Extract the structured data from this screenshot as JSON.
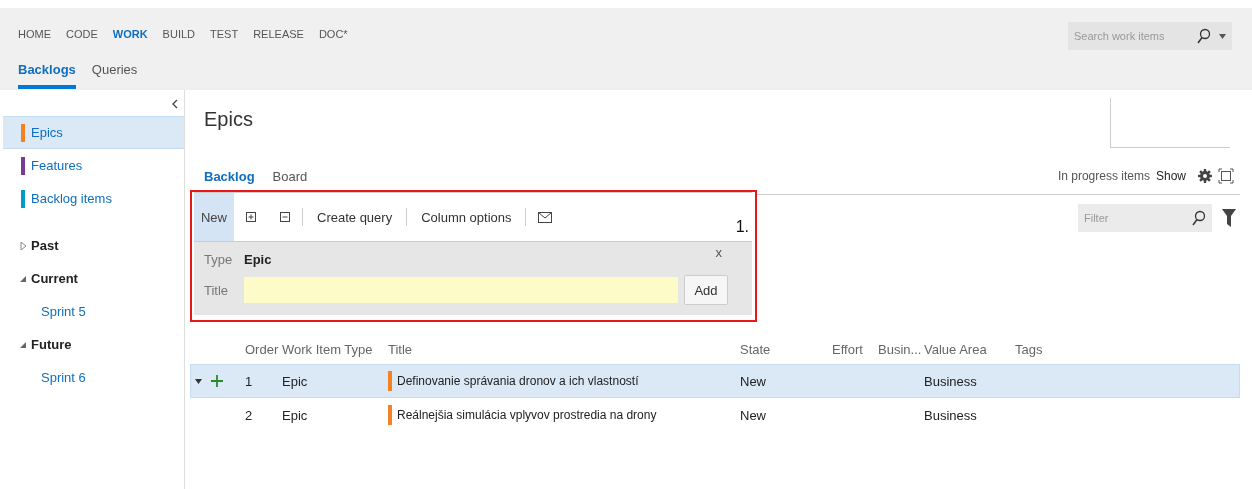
{
  "nav": {
    "hubs": [
      {
        "label": "HOME",
        "selected": false
      },
      {
        "label": "CODE",
        "selected": false
      },
      {
        "label": "WORK",
        "selected": true
      },
      {
        "label": "BUILD",
        "selected": false
      },
      {
        "label": "TEST",
        "selected": false
      },
      {
        "label": "RELEASE",
        "selected": false
      },
      {
        "label": "DOC*",
        "selected": false
      }
    ],
    "tabs": [
      {
        "label": "Backlogs",
        "selected": true
      },
      {
        "label": "Queries",
        "selected": false
      }
    ],
    "search": {
      "placeholder": "Search work items"
    }
  },
  "sidebar": {
    "backlogs": [
      {
        "label": "Epics",
        "color": "#f58220",
        "selected": true
      },
      {
        "label": "Features",
        "color": "#773b93",
        "selected": false
      },
      {
        "label": "Backlog items",
        "color": "#009ccc",
        "selected": false
      }
    ],
    "iterations": [
      {
        "label": "Past",
        "expanded": false
      },
      {
        "label": "Current",
        "expanded": true,
        "children": [
          {
            "label": "Sprint 5"
          }
        ]
      },
      {
        "label": "Future",
        "expanded": true,
        "children": [
          {
            "label": "Sprint 6"
          }
        ]
      }
    ]
  },
  "page": {
    "title": "Epics",
    "views": [
      {
        "label": "Backlog",
        "selected": true
      },
      {
        "label": "Board",
        "selected": false
      }
    ],
    "in_progress": {
      "label": "In progress items",
      "value": "Show"
    },
    "toolbar": {
      "new": {
        "label": "New",
        "active": true
      },
      "actions": [
        "Create query",
        "Column options"
      ]
    },
    "annotation": "1.",
    "add_panel": {
      "type_label": "Type",
      "type_value": "Epic",
      "title_label": "Title",
      "close": "x",
      "button": "Add"
    },
    "filter": {
      "placeholder": "Filter"
    }
  },
  "table": {
    "columns": [
      "Order",
      "Work Item Type",
      "Title",
      "State",
      "Effort",
      "Busin...",
      "Value Area",
      "Tags"
    ],
    "rows": [
      {
        "order": "1",
        "type": "Epic",
        "title": "Definovanie správania dronov a ich vlastností",
        "color": "#f58220",
        "state": "New",
        "value_area": "Business",
        "selected": true
      },
      {
        "order": "2",
        "type": "Epic",
        "title": "Reálnejšia simulácia vplyvov prostredia na drony",
        "color": "#f58220",
        "state": "New",
        "value_area": "Business",
        "selected": false
      }
    ]
  }
}
